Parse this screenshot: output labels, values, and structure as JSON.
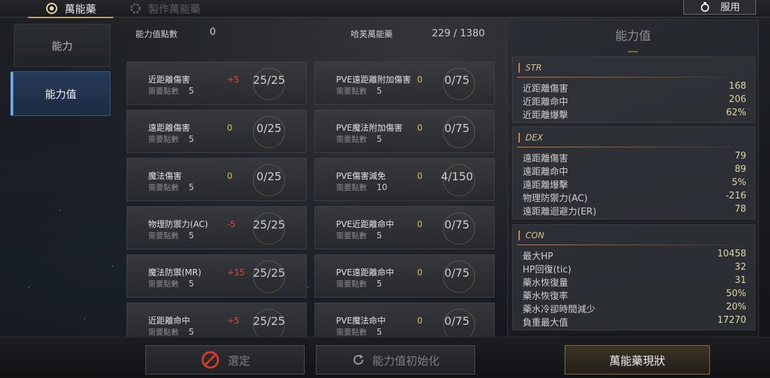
{
  "tabs": {
    "active": "萬能藥",
    "inactive": "製作萬能藥"
  },
  "use_button": "服用",
  "sidebar": [
    {
      "label": "能力"
    },
    {
      "label": "能力值"
    }
  ],
  "header": {
    "points_label": "能力值點數",
    "points_value": "0",
    "elixir_label": "哈芙萬能藥",
    "elixir_value": "229 / 1380"
  },
  "req_label": "需要點數",
  "cards_left": [
    {
      "name": "近距離傷害",
      "bonus": "+5",
      "bonus_color": "red",
      "req": "5",
      "progress": "25/25"
    },
    {
      "name": "遠距離傷害",
      "bonus": "0",
      "bonus_color": "yel",
      "req": "5",
      "progress": "0/25"
    },
    {
      "name": "魔法傷害",
      "bonus": "0",
      "bonus_color": "yel",
      "req": "5",
      "progress": "0/25"
    },
    {
      "name": "物理防禦力(AC)",
      "bonus": "-5",
      "bonus_color": "red",
      "req": "5",
      "progress": "25/25"
    },
    {
      "name": "魔法防禦(MR)",
      "bonus": "+15",
      "bonus_color": "red",
      "req": "5",
      "progress": "25/25"
    },
    {
      "name": "近距離命中",
      "bonus": "+5",
      "bonus_color": "red",
      "req": "5",
      "progress": "25/25"
    }
  ],
  "cards_right": [
    {
      "name": "PVE遠距離附加傷害",
      "bonus": "0",
      "bonus_color": "yel",
      "req": "5",
      "progress": "0/75"
    },
    {
      "name": "PVE魔法附加傷害",
      "bonus": "0",
      "bonus_color": "yel",
      "req": "5",
      "progress": "0/75"
    },
    {
      "name": "PVE傷害減免",
      "bonus": "0",
      "bonus_color": "yel",
      "req": "10",
      "progress": "4/150"
    },
    {
      "name": "PVE近距離命中",
      "bonus": "0",
      "bonus_color": "yel",
      "req": "5",
      "progress": "0/75"
    },
    {
      "name": "PVE遠距離命中",
      "bonus": "0",
      "bonus_color": "yel",
      "req": "5",
      "progress": "0/75"
    },
    {
      "name": "PVE魔法命中",
      "bonus": "0",
      "bonus_color": "yel",
      "req": "5",
      "progress": "0/75"
    }
  ],
  "panel": {
    "title": "能力值",
    "sections": [
      {
        "head": "STR",
        "rows": [
          {
            "label": "近距離傷害",
            "value": "168"
          },
          {
            "label": "近距離命中",
            "value": "206"
          },
          {
            "label": "近距離爆擊",
            "value": "62%"
          }
        ]
      },
      {
        "head": "DEX",
        "rows": [
          {
            "label": "遠距離傷害",
            "value": "79"
          },
          {
            "label": "遠距離命中",
            "value": "89"
          },
          {
            "label": "遠距離爆擊",
            "value": "5%"
          },
          {
            "label": "物理防禦力(AC)",
            "value": "-216"
          },
          {
            "label": "遠距離迴避力(ER)",
            "value": "78"
          }
        ]
      },
      {
        "head": "CON",
        "rows": [
          {
            "label": "最大HP",
            "value": "10458"
          },
          {
            "label": "HP回復(tic)",
            "value": "32"
          },
          {
            "label": "藥水恢復量",
            "value": "31"
          },
          {
            "label": "藥水恢復率",
            "value": "50%"
          },
          {
            "label": "藥水冷卻時間減少",
            "value": "20%"
          },
          {
            "label": "負重最大值",
            "value": "17270"
          }
        ]
      }
    ]
  },
  "buttons": {
    "confirm": "選定",
    "reset": "能力值初始化",
    "status": "萬能藥現狀"
  },
  "colors": {
    "red": "#e14b3d",
    "yellow": "#d6c25a",
    "accent": "#c8a55a"
  }
}
